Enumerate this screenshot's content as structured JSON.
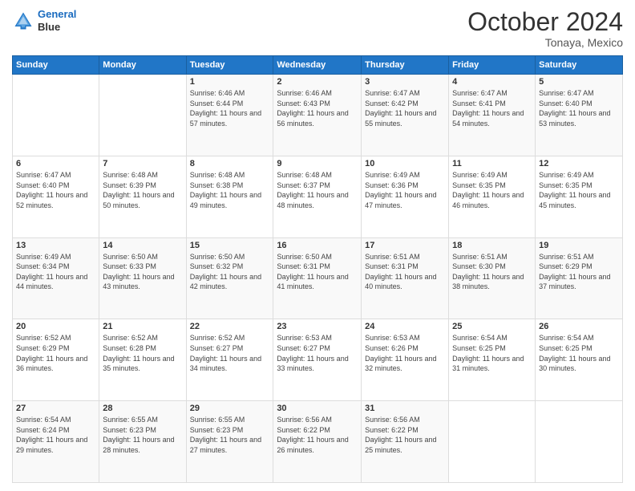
{
  "logo": {
    "line1": "General",
    "line2": "Blue"
  },
  "header": {
    "month": "October 2024",
    "location": "Tonaya, Mexico"
  },
  "days_of_week": [
    "Sunday",
    "Monday",
    "Tuesday",
    "Wednesday",
    "Thursday",
    "Friday",
    "Saturday"
  ],
  "weeks": [
    [
      {
        "day": "",
        "info": ""
      },
      {
        "day": "",
        "info": ""
      },
      {
        "day": "1",
        "info": "Sunrise: 6:46 AM\nSunset: 6:44 PM\nDaylight: 11 hours and 57 minutes."
      },
      {
        "day": "2",
        "info": "Sunrise: 6:46 AM\nSunset: 6:43 PM\nDaylight: 11 hours and 56 minutes."
      },
      {
        "day": "3",
        "info": "Sunrise: 6:47 AM\nSunset: 6:42 PM\nDaylight: 11 hours and 55 minutes."
      },
      {
        "day": "4",
        "info": "Sunrise: 6:47 AM\nSunset: 6:41 PM\nDaylight: 11 hours and 54 minutes."
      },
      {
        "day": "5",
        "info": "Sunrise: 6:47 AM\nSunset: 6:40 PM\nDaylight: 11 hours and 53 minutes."
      }
    ],
    [
      {
        "day": "6",
        "info": "Sunrise: 6:47 AM\nSunset: 6:40 PM\nDaylight: 11 hours and 52 minutes."
      },
      {
        "day": "7",
        "info": "Sunrise: 6:48 AM\nSunset: 6:39 PM\nDaylight: 11 hours and 50 minutes."
      },
      {
        "day": "8",
        "info": "Sunrise: 6:48 AM\nSunset: 6:38 PM\nDaylight: 11 hours and 49 minutes."
      },
      {
        "day": "9",
        "info": "Sunrise: 6:48 AM\nSunset: 6:37 PM\nDaylight: 11 hours and 48 minutes."
      },
      {
        "day": "10",
        "info": "Sunrise: 6:49 AM\nSunset: 6:36 PM\nDaylight: 11 hours and 47 minutes."
      },
      {
        "day": "11",
        "info": "Sunrise: 6:49 AM\nSunset: 6:35 PM\nDaylight: 11 hours and 46 minutes."
      },
      {
        "day": "12",
        "info": "Sunrise: 6:49 AM\nSunset: 6:35 PM\nDaylight: 11 hours and 45 minutes."
      }
    ],
    [
      {
        "day": "13",
        "info": "Sunrise: 6:49 AM\nSunset: 6:34 PM\nDaylight: 11 hours and 44 minutes."
      },
      {
        "day": "14",
        "info": "Sunrise: 6:50 AM\nSunset: 6:33 PM\nDaylight: 11 hours and 43 minutes."
      },
      {
        "day": "15",
        "info": "Sunrise: 6:50 AM\nSunset: 6:32 PM\nDaylight: 11 hours and 42 minutes."
      },
      {
        "day": "16",
        "info": "Sunrise: 6:50 AM\nSunset: 6:31 PM\nDaylight: 11 hours and 41 minutes."
      },
      {
        "day": "17",
        "info": "Sunrise: 6:51 AM\nSunset: 6:31 PM\nDaylight: 11 hours and 40 minutes."
      },
      {
        "day": "18",
        "info": "Sunrise: 6:51 AM\nSunset: 6:30 PM\nDaylight: 11 hours and 38 minutes."
      },
      {
        "day": "19",
        "info": "Sunrise: 6:51 AM\nSunset: 6:29 PM\nDaylight: 11 hours and 37 minutes."
      }
    ],
    [
      {
        "day": "20",
        "info": "Sunrise: 6:52 AM\nSunset: 6:29 PM\nDaylight: 11 hours and 36 minutes."
      },
      {
        "day": "21",
        "info": "Sunrise: 6:52 AM\nSunset: 6:28 PM\nDaylight: 11 hours and 35 minutes."
      },
      {
        "day": "22",
        "info": "Sunrise: 6:52 AM\nSunset: 6:27 PM\nDaylight: 11 hours and 34 minutes."
      },
      {
        "day": "23",
        "info": "Sunrise: 6:53 AM\nSunset: 6:27 PM\nDaylight: 11 hours and 33 minutes."
      },
      {
        "day": "24",
        "info": "Sunrise: 6:53 AM\nSunset: 6:26 PM\nDaylight: 11 hours and 32 minutes."
      },
      {
        "day": "25",
        "info": "Sunrise: 6:54 AM\nSunset: 6:25 PM\nDaylight: 11 hours and 31 minutes."
      },
      {
        "day": "26",
        "info": "Sunrise: 6:54 AM\nSunset: 6:25 PM\nDaylight: 11 hours and 30 minutes."
      }
    ],
    [
      {
        "day": "27",
        "info": "Sunrise: 6:54 AM\nSunset: 6:24 PM\nDaylight: 11 hours and 29 minutes."
      },
      {
        "day": "28",
        "info": "Sunrise: 6:55 AM\nSunset: 6:23 PM\nDaylight: 11 hours and 28 minutes."
      },
      {
        "day": "29",
        "info": "Sunrise: 6:55 AM\nSunset: 6:23 PM\nDaylight: 11 hours and 27 minutes."
      },
      {
        "day": "30",
        "info": "Sunrise: 6:56 AM\nSunset: 6:22 PM\nDaylight: 11 hours and 26 minutes."
      },
      {
        "day": "31",
        "info": "Sunrise: 6:56 AM\nSunset: 6:22 PM\nDaylight: 11 hours and 25 minutes."
      },
      {
        "day": "",
        "info": ""
      },
      {
        "day": "",
        "info": ""
      }
    ]
  ]
}
